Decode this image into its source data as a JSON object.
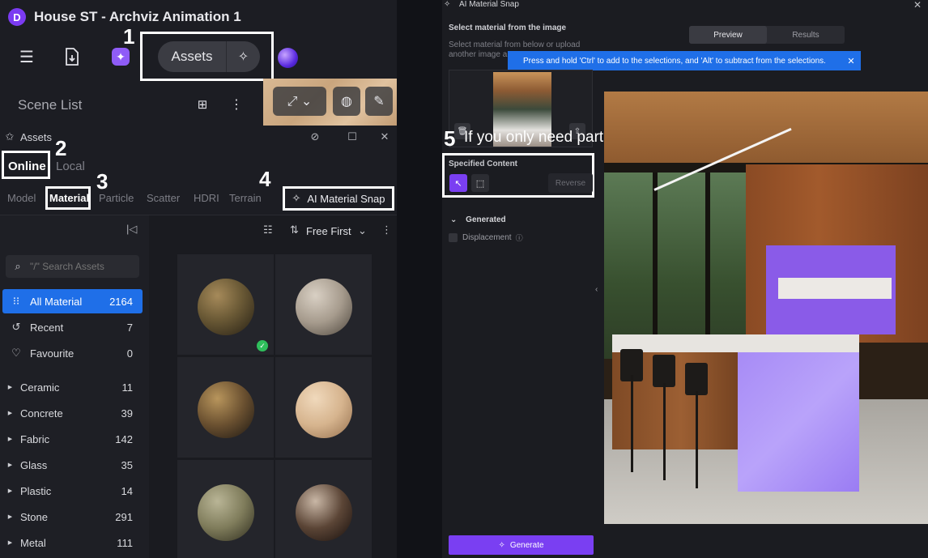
{
  "app": {
    "title": "House ST - Archviz Animation 1",
    "logo_letter": "D"
  },
  "toolbar": {
    "assets_label": "Assets"
  },
  "scene_list": {
    "title": "Scene List"
  },
  "assets_panel": {
    "title": "Assets",
    "source_tabs": {
      "online": "Online",
      "local": "Local"
    },
    "category_tabs": [
      "Model",
      "Material",
      "Particle",
      "Scatter",
      "HDRI",
      "Terrain"
    ],
    "ai_snap_button": "AI Material Snap",
    "sort_label": "Free First",
    "search_placeholder": "\"/\" Search Assets",
    "special_items": [
      {
        "label": "All Material",
        "count": "2164"
      },
      {
        "label": "Recent",
        "count": "7"
      },
      {
        "label": "Favourite",
        "count": "0"
      }
    ],
    "categories": [
      {
        "label": "Ceramic",
        "count": "11"
      },
      {
        "label": "Concrete",
        "count": "39"
      },
      {
        "label": "Fabric",
        "count": "142"
      },
      {
        "label": "Glass",
        "count": "35"
      },
      {
        "label": "Plastic",
        "count": "14"
      },
      {
        "label": "Stone",
        "count": "291"
      },
      {
        "label": "Metal",
        "count": "111"
      }
    ]
  },
  "annotations": {
    "n1": "1",
    "n2": "2",
    "n3": "3",
    "n4": "4",
    "n5": "5",
    "tip5": "If you only need part of the image"
  },
  "ai_snap": {
    "window_title": "AI Material Snap",
    "section_title": "Select material from the image",
    "description": "Select material from below or upload another image a",
    "tabs": {
      "preview": "Preview",
      "results": "Results"
    },
    "toast": "Press and hold 'Ctrl' to add to the selections, and 'Alt' to subtract from the selections.",
    "specified_content": "Specified Content",
    "reverse_label": "Reverse",
    "generated_title": "Generated",
    "displacement_label": "Displacement",
    "generate_button": "Generate"
  },
  "colors": {
    "accent": "#7a3ff2",
    "selection_blue": "#1f6fe8",
    "success": "#2fbf5c"
  }
}
